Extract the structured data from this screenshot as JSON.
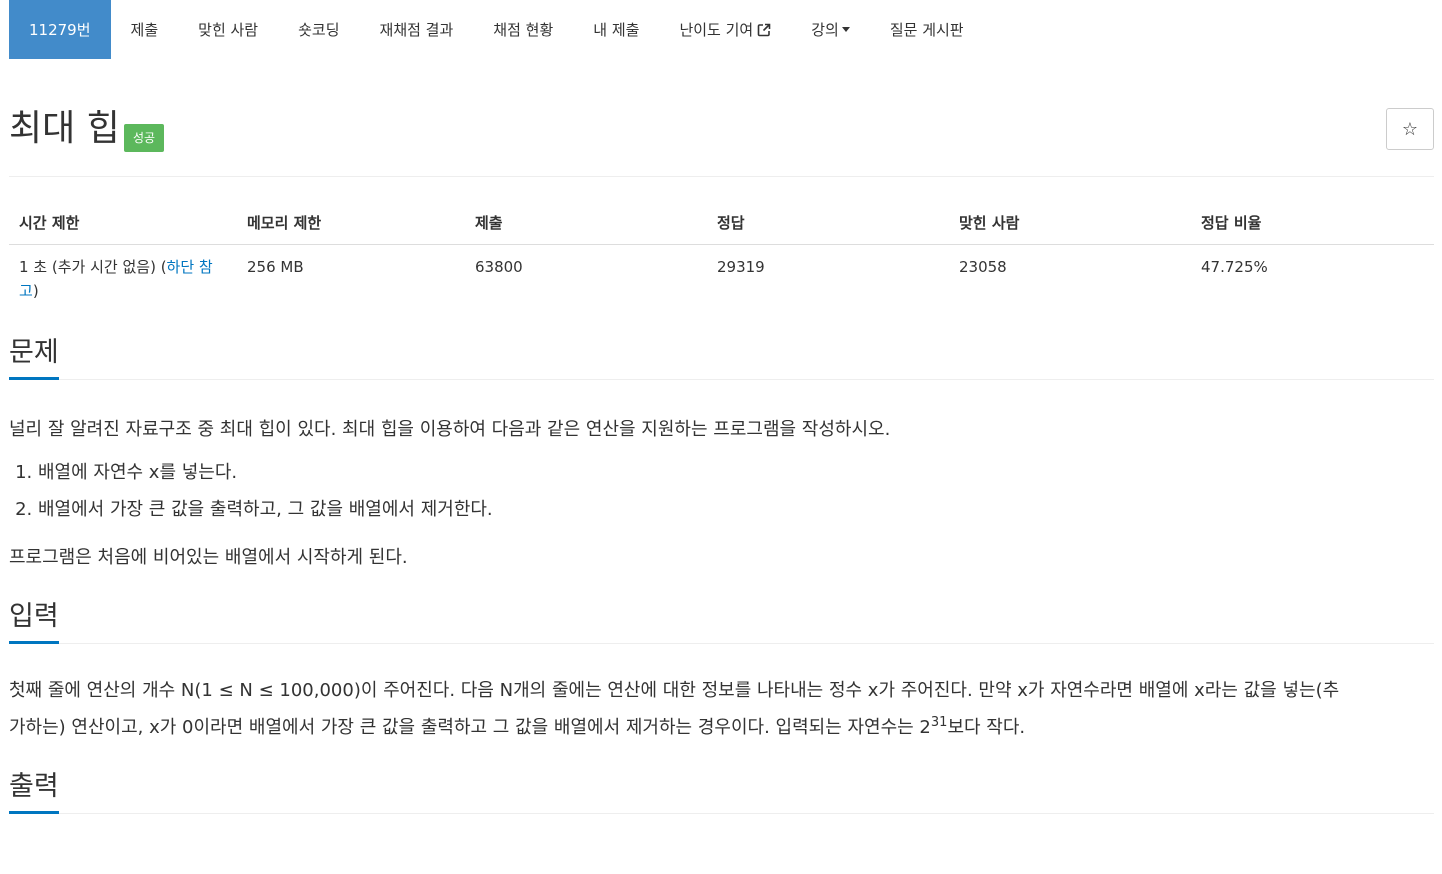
{
  "nav": {
    "items": [
      {
        "label": "11279번",
        "active": true
      },
      {
        "label": "제출"
      },
      {
        "label": "맞힌 사람"
      },
      {
        "label": "숏코딩"
      },
      {
        "label": "재채점 결과"
      },
      {
        "label": "채점 현황"
      },
      {
        "label": "내 제출"
      },
      {
        "label": "난이도 기여",
        "icon": "external-link-icon"
      },
      {
        "label": "강의",
        "icon": "caret-down-icon"
      },
      {
        "label": "질문 게시판"
      }
    ]
  },
  "problem": {
    "title": "최대 힙",
    "result_label": "성공",
    "star_icon": "☆"
  },
  "info": {
    "headers": [
      "시간 제한",
      "메모리 제한",
      "제출",
      "정답",
      "맞힌 사람",
      "정답 비율"
    ],
    "time_limit_prefix": "1 초 (추가 시간 없음) (",
    "time_limit_link": "하단 참고",
    "time_limit_suffix": ")",
    "memory_limit": "256 MB",
    "submissions": "63800",
    "accepted": "29319",
    "solved_users": "23058",
    "accept_ratio": "47.725%"
  },
  "description": {
    "heading": "문제",
    "intro": "널리 잘 알려진 자료구조 중 최대 힙이 있다. 최대 힙을 이용하여 다음과 같은 연산을 지원하는 프로그램을 작성하시오.",
    "operations": [
      "배열에 자연수 x를 넣는다.",
      "배열에서 가장 큰 값을 출력하고, 그 값을 배열에서 제거한다."
    ],
    "outro": "프로그램은 처음에 비어있는 배열에서 시작하게 된다."
  },
  "input": {
    "heading": "입력",
    "text_line1": "첫째 줄에 연산의 개수 N(1 ≤ N ≤ 100,000)이 주어진다. 다음 N개의 줄에는 연산에 대한 정보를 나타내는 정수 x가 주어진다. 만약 x가 자연수라면 배열에 x라는 값을 넣는(추",
    "text_line2_pre": "가하는) 연산이고, x가 0이라면 배열에서 가장 큰 값을 출력하고 그 값을 배열에서 제거하는 경우이다. 입력되는 자연수는 2",
    "text_sup": "31",
    "text_line2_post": "보다 작다."
  },
  "output": {
    "heading": "출력"
  },
  "colors": {
    "active_nav": "#428bca",
    "success_label": "#5cb85c",
    "link": "#0076c0"
  }
}
